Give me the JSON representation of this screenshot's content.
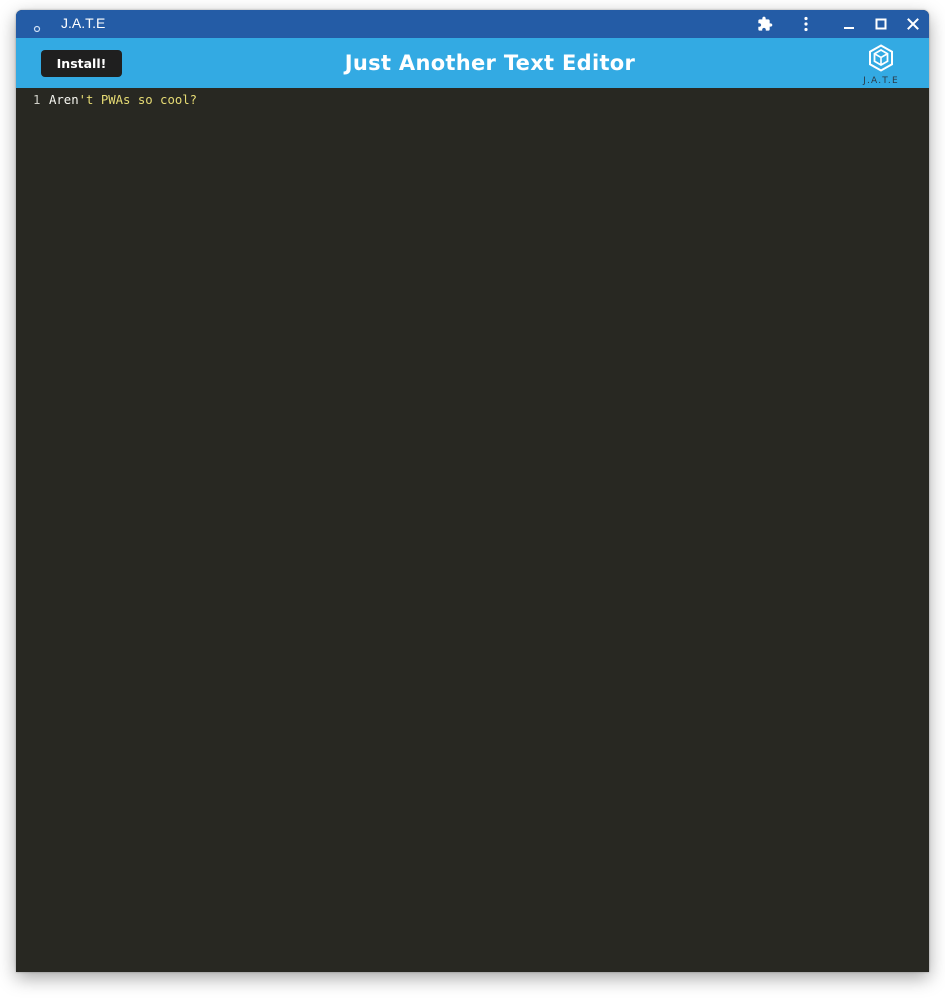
{
  "window": {
    "title": "J.A.T.E",
    "controls": {
      "extensions_icon": "puzzle-icon",
      "menu_icon": "kebab-menu-icon",
      "minimize_icon": "minimize-icon",
      "maximize_icon": "maximize-icon",
      "close_icon": "close-icon"
    }
  },
  "header": {
    "install_label": "Install!",
    "title": "Just Another Text Editor",
    "logo_text": "J.A.T.E"
  },
  "editor": {
    "lines": [
      {
        "number": "1",
        "tokens": [
          {
            "text": "Aren",
            "kind": "plain"
          },
          {
            "text": "'t PWAs so cool?",
            "kind": "string"
          }
        ]
      }
    ]
  },
  "colors": {
    "titlebar": "#245ca6",
    "header": "#33aae3",
    "editor_bg": "#282822",
    "install_button": "#1f1f1f",
    "text_plain": "#f8f8f2",
    "text_string": "#e6db74"
  }
}
